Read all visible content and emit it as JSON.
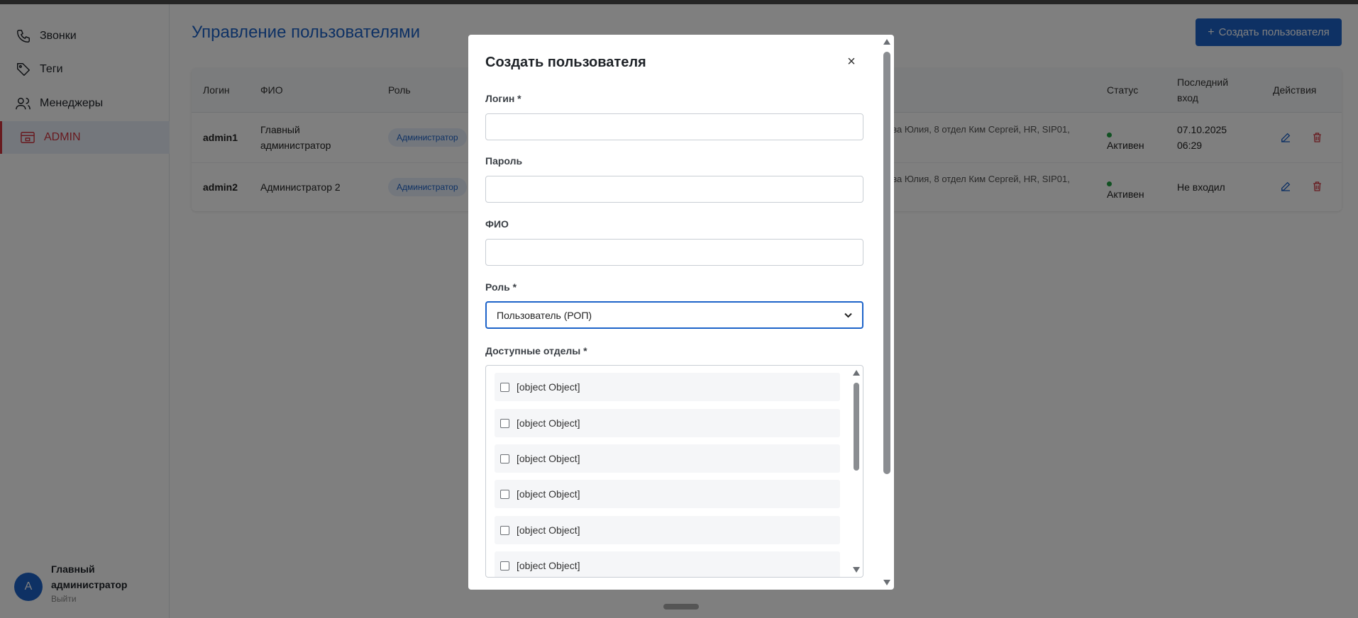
{
  "sidebar": {
    "items": [
      {
        "label": "Звонки",
        "icon": "phone-icon"
      },
      {
        "label": "Теги",
        "icon": "tag-icon"
      },
      {
        "label": "Менеджеры",
        "icon": "users-icon"
      },
      {
        "label": "ADMIN",
        "icon": "admin-panel-icon"
      }
    ],
    "user": {
      "initial": "A",
      "name": "Главный администратор",
      "logout": "Выйти"
    }
  },
  "header": {
    "title": "Управление пользователями",
    "create_button": "Создать пользователя"
  },
  "table": {
    "columns": [
      "Логин",
      "ФИО",
      "Роль",
      "Статус",
      "Последний вход",
      "Действия"
    ],
    "rows": [
      {
        "login": "admin1",
        "name": "Главный администратор",
        "role": "Администратор",
        "depts": "ова Юлия, 8 отдел Ким Сергей, HR, SIP01,",
        "status": "Активен",
        "last_login": "07.10.2025 06:29"
      },
      {
        "login": "admin2",
        "name": "Администратор 2",
        "role": "Администратор",
        "depts": "ова Юлия, 8 отдел Ким Сергей, HR, SIP01,",
        "status": "Активен",
        "last_login": "Не входил"
      }
    ]
  },
  "modal": {
    "title": "Создать пользователя",
    "close": "×",
    "fields": {
      "login_label": "Логин *",
      "login_value": "",
      "password_label": "Пароль",
      "password_value": "",
      "fio_label": "ФИО",
      "fio_value": "",
      "role_label": "Роль *",
      "role_value": "Пользователь (РОП)",
      "depts_label": "Доступные отделы *"
    },
    "departments": [
      "[object Object]",
      "[object Object]",
      "[object Object]",
      "[object Object]",
      "[object Object]",
      "[object Object]"
    ]
  },
  "colors": {
    "accent": "#1d63c9",
    "active_nav": "#d0343f",
    "status_active": "#22a344",
    "delete": "#d0343f"
  }
}
